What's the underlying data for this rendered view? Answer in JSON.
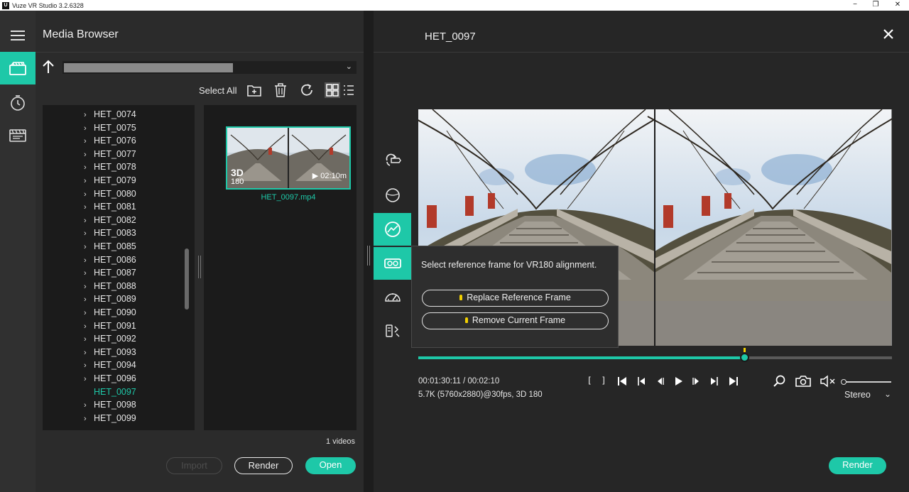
{
  "window": {
    "app_icon": "U",
    "title": "Vuze VR Studio 3.2.6328",
    "minimize": "−",
    "maximize": "❐",
    "close": "✕"
  },
  "sidebar": {
    "items": [
      {
        "name": "media-icon",
        "active": true
      },
      {
        "name": "history-icon",
        "active": false
      },
      {
        "name": "clapperboard-icon",
        "active": false
      }
    ]
  },
  "media_browser": {
    "title": "Media Browser",
    "path_chevron": "⌄",
    "select_all": "Select All",
    "tree": [
      {
        "label": "HET_0074",
        "arrow": "›"
      },
      {
        "label": "HET_0075",
        "arrow": "›"
      },
      {
        "label": "HET_0076",
        "arrow": "›"
      },
      {
        "label": "HET_0077",
        "arrow": "›"
      },
      {
        "label": "HET_0078",
        "arrow": "›"
      },
      {
        "label": "HET_0079",
        "arrow": "›"
      },
      {
        "label": "HET_0080",
        "arrow": "›"
      },
      {
        "label": "HET_0081",
        "arrow": "›"
      },
      {
        "label": "HET_0082",
        "arrow": "›"
      },
      {
        "label": "HET_0083",
        "arrow": "›"
      },
      {
        "label": "HET_0085",
        "arrow": "›"
      },
      {
        "label": "HET_0086",
        "arrow": "›"
      },
      {
        "label": "HET_0087",
        "arrow": "›"
      },
      {
        "label": "HET_0088",
        "arrow": "›"
      },
      {
        "label": "HET_0089",
        "arrow": "›"
      },
      {
        "label": "HET_0090",
        "arrow": "›"
      },
      {
        "label": "HET_0091",
        "arrow": "›"
      },
      {
        "label": "HET_0092",
        "arrow": "›"
      },
      {
        "label": "HET_0093",
        "arrow": "›"
      },
      {
        "label": "HET_0094",
        "arrow": "›"
      },
      {
        "label": "HET_0096",
        "arrow": "›"
      },
      {
        "label": "HET_0097",
        "arrow": "",
        "selected": true
      },
      {
        "label": "HET_0098",
        "arrow": "›"
      },
      {
        "label": "HET_0099",
        "arrow": "›"
      }
    ],
    "thumbnail": {
      "badge_3d": "3D",
      "badge_180": "180",
      "duration": "▶ 02:10m",
      "filename": "HET_0097.mp4"
    },
    "video_count": "1 videos",
    "buttons": {
      "import": "Import",
      "render": "Render",
      "open": "Open"
    }
  },
  "viewer": {
    "title": "HET_0097",
    "popup": {
      "message": "Select reference frame for VR180 alignment.",
      "replace": "Replace Reference Frame",
      "remove": "Remove Current Frame"
    },
    "playback": {
      "progress": 0.688,
      "reference_mark": 0.688,
      "timecode": "00:01:30:11 / 00:02:10",
      "info": "5.7K (5760x2880)@30fps, 3D 180",
      "mark_in": "[",
      "mark_out": "]"
    },
    "volume": 0.0,
    "stereo_label": "Stereo",
    "stereo_chevron": "⌄",
    "render": "Render"
  },
  "colors": {
    "accent": "#1ec8a8",
    "marker": "#f2d000",
    "panel": "#2b2b2b",
    "background": "#262626"
  }
}
